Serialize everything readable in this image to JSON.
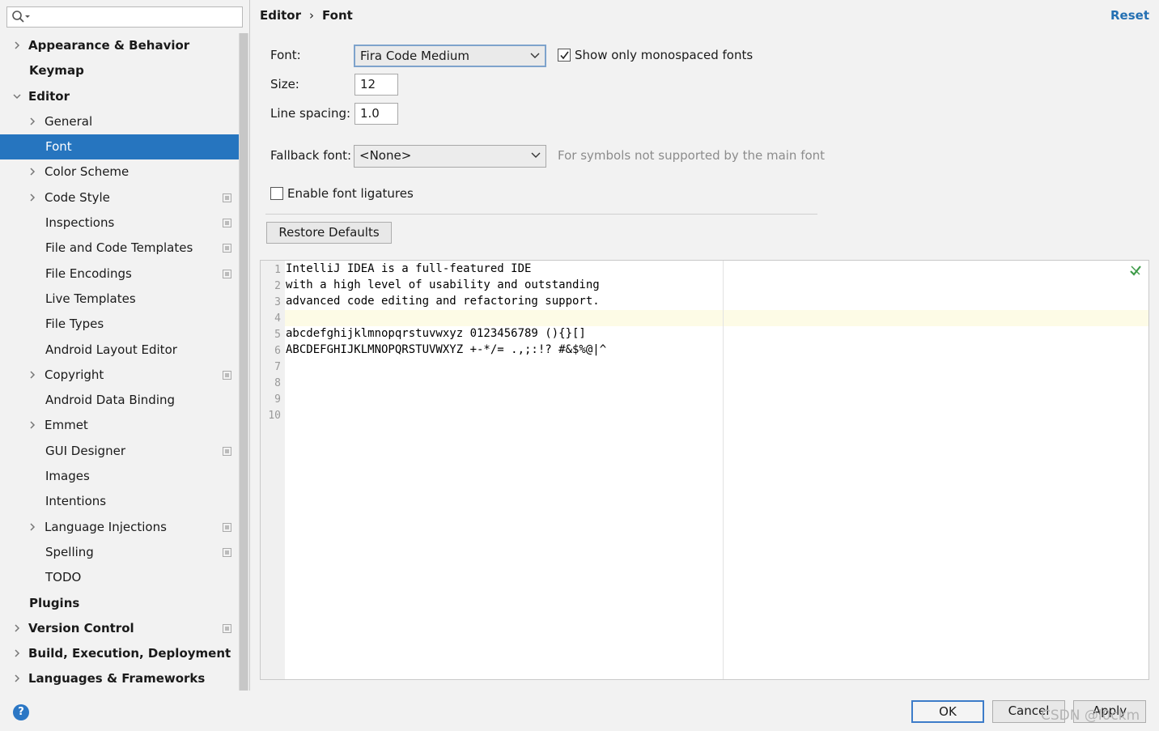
{
  "sidebar": {
    "search": {
      "value": "",
      "placeholder": ""
    },
    "items": [
      {
        "label": "Appearance & Behavior",
        "bold": true,
        "level": 0,
        "expandable": true,
        "expanded": false,
        "project": false
      },
      {
        "label": "Keymap",
        "bold": true,
        "level": 0,
        "expandable": false,
        "project": false
      },
      {
        "label": "Editor",
        "bold": true,
        "level": 0,
        "expandable": true,
        "expanded": true,
        "project": false
      },
      {
        "label": "General",
        "level": 1,
        "expandable": true,
        "expanded": false,
        "project": false
      },
      {
        "label": "Font",
        "level": 1,
        "expandable": false,
        "selected": true,
        "project": false
      },
      {
        "label": "Color Scheme",
        "level": 1,
        "expandable": true,
        "expanded": false,
        "project": false
      },
      {
        "label": "Code Style",
        "level": 1,
        "expandable": true,
        "expanded": false,
        "project": true
      },
      {
        "label": "Inspections",
        "level": 1,
        "expandable": false,
        "project": true
      },
      {
        "label": "File and Code Templates",
        "level": 1,
        "expandable": false,
        "project": true
      },
      {
        "label": "File Encodings",
        "level": 1,
        "expandable": false,
        "project": true
      },
      {
        "label": "Live Templates",
        "level": 1,
        "expandable": false,
        "project": false
      },
      {
        "label": "File Types",
        "level": 1,
        "expandable": false,
        "project": false
      },
      {
        "label": "Android Layout Editor",
        "level": 1,
        "expandable": false,
        "project": false
      },
      {
        "label": "Copyright",
        "level": 1,
        "expandable": true,
        "expanded": false,
        "project": true
      },
      {
        "label": "Android Data Binding",
        "level": 1,
        "expandable": false,
        "project": false
      },
      {
        "label": "Emmet",
        "level": 1,
        "expandable": true,
        "expanded": false,
        "project": false
      },
      {
        "label": "GUI Designer",
        "level": 1,
        "expandable": false,
        "project": true
      },
      {
        "label": "Images",
        "level": 1,
        "expandable": false,
        "project": false
      },
      {
        "label": "Intentions",
        "level": 1,
        "expandable": false,
        "project": false
      },
      {
        "label": "Language Injections",
        "level": 1,
        "expandable": true,
        "expanded": false,
        "project": true
      },
      {
        "label": "Spelling",
        "level": 1,
        "expandable": false,
        "project": true
      },
      {
        "label": "TODO",
        "level": 1,
        "expandable": false,
        "project": false
      },
      {
        "label": "Plugins",
        "bold": true,
        "level": 0,
        "expandable": false,
        "project": false
      },
      {
        "label": "Version Control",
        "bold": true,
        "level": 0,
        "expandable": true,
        "expanded": false,
        "project": true
      },
      {
        "label": "Build, Execution, Deployment",
        "bold": true,
        "level": 0,
        "expandable": true,
        "expanded": false,
        "project": false
      },
      {
        "label": "Languages & Frameworks",
        "bold": true,
        "level": 0,
        "expandable": true,
        "expanded": false,
        "project": false
      }
    ]
  },
  "header": {
    "breadcrumb_parent": "Editor",
    "breadcrumb_sep": "›",
    "breadcrumb_current": "Font",
    "reset_label": "Reset"
  },
  "form": {
    "font_label": "Font:",
    "font_value": "Fira Code Medium",
    "monospaced_label": "Show only monospaced fonts",
    "monospaced_checked": true,
    "size_label": "Size:",
    "size_value": "12",
    "line_spacing_label": "Line spacing:",
    "line_spacing_value": "1.0",
    "fallback_label": "Fallback font:",
    "fallback_value": "<None>",
    "fallback_hint": "For symbols not supported by the main font",
    "ligatures_label": "Enable font ligatures",
    "ligatures_checked": false,
    "restore_label": "Restore Defaults"
  },
  "preview": {
    "lines": [
      "IntelliJ IDEA is a full-featured IDE",
      "with a high level of usability and outstanding",
      "advanced code editing and refactoring support.",
      "",
      "abcdefghijklmnopqrstuvwxyz 0123456789 (){}[]",
      "ABCDEFGHIJKLMNOPQRSTUVWXYZ +-*/= .,;:!? #&$%@|^",
      "",
      "",
      "",
      ""
    ],
    "line_numbers": [
      "1",
      "2",
      "3",
      "4",
      "5",
      "6",
      "7",
      "8",
      "9",
      "10"
    ]
  },
  "footer": {
    "help_label": "?",
    "ok_label": "OK",
    "cancel_label": "Cancel",
    "apply_label": "Apply",
    "watermark": "CSDN @l0ckm"
  },
  "colors": {
    "selection": "#2675bf",
    "link": "#2470b3",
    "default_button_border": "#3d7cc9"
  }
}
